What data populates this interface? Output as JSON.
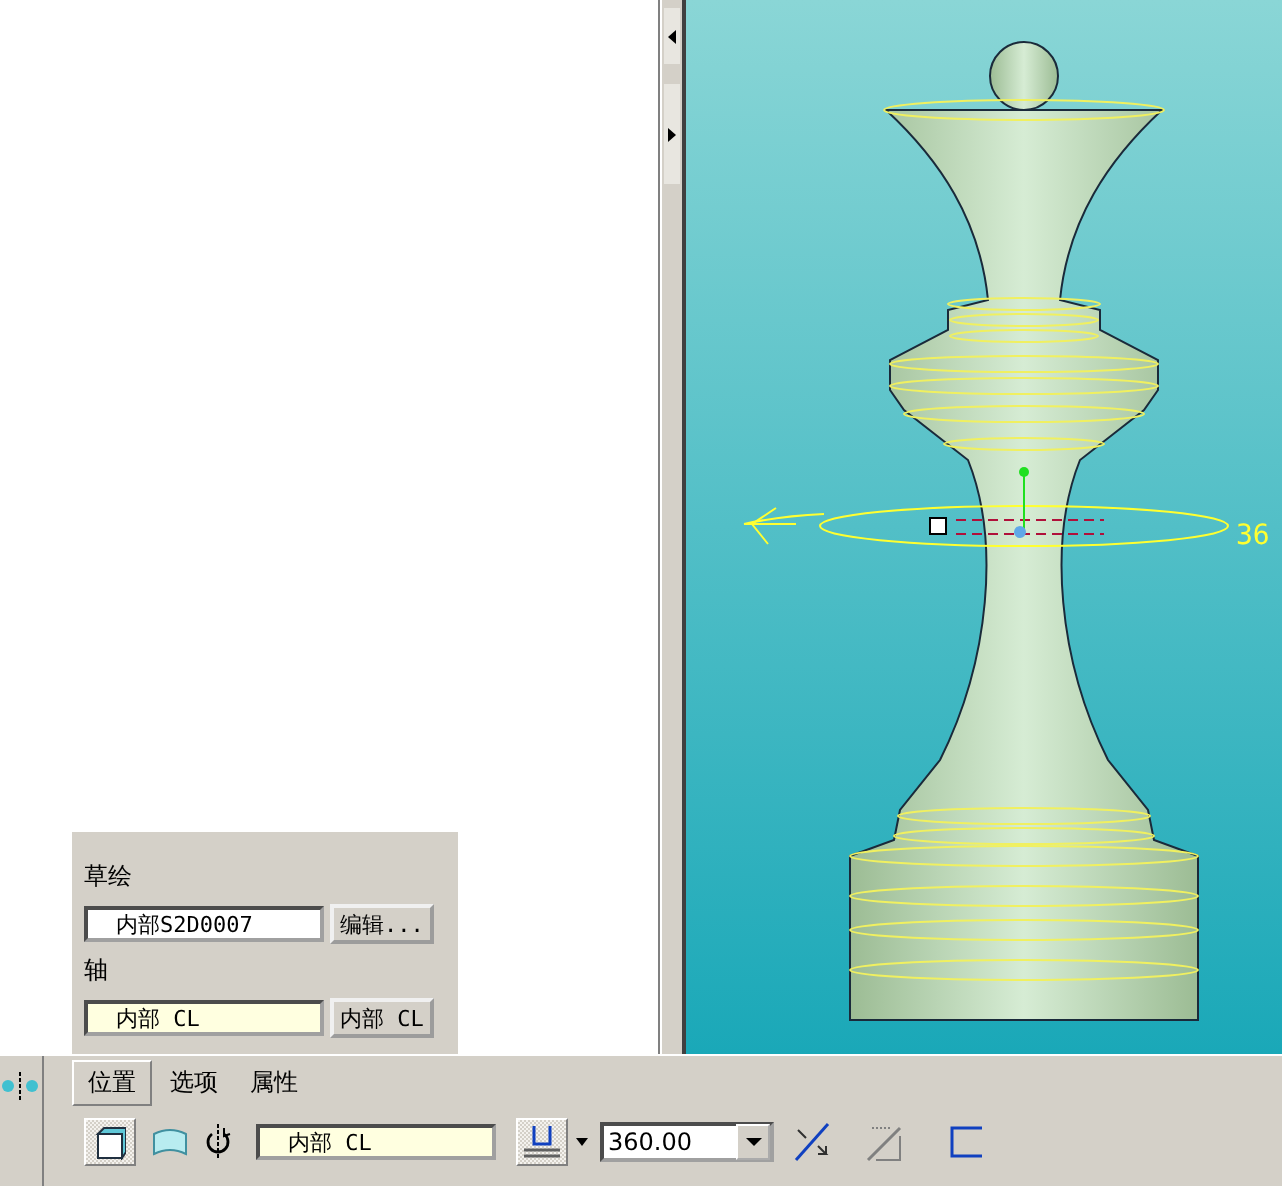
{
  "slide_panel": {
    "sketch_label": "草绘",
    "sketch_field": "内部S2D0007",
    "edit_button": "编辑...",
    "axis_label": "轴",
    "axis_field": "内部 CL",
    "axis_button": "内部 CL"
  },
  "tabs": [
    {
      "label": "位置",
      "selected": true
    },
    {
      "label": "选项",
      "selected": false
    },
    {
      "label": "属性",
      "selected": false
    }
  ],
  "toolbar": {
    "solid_selected": true,
    "surface_selected": false,
    "axis_field": "内部 CL",
    "angle": "360.00"
  },
  "viewport": {
    "dimension_label": "36"
  }
}
